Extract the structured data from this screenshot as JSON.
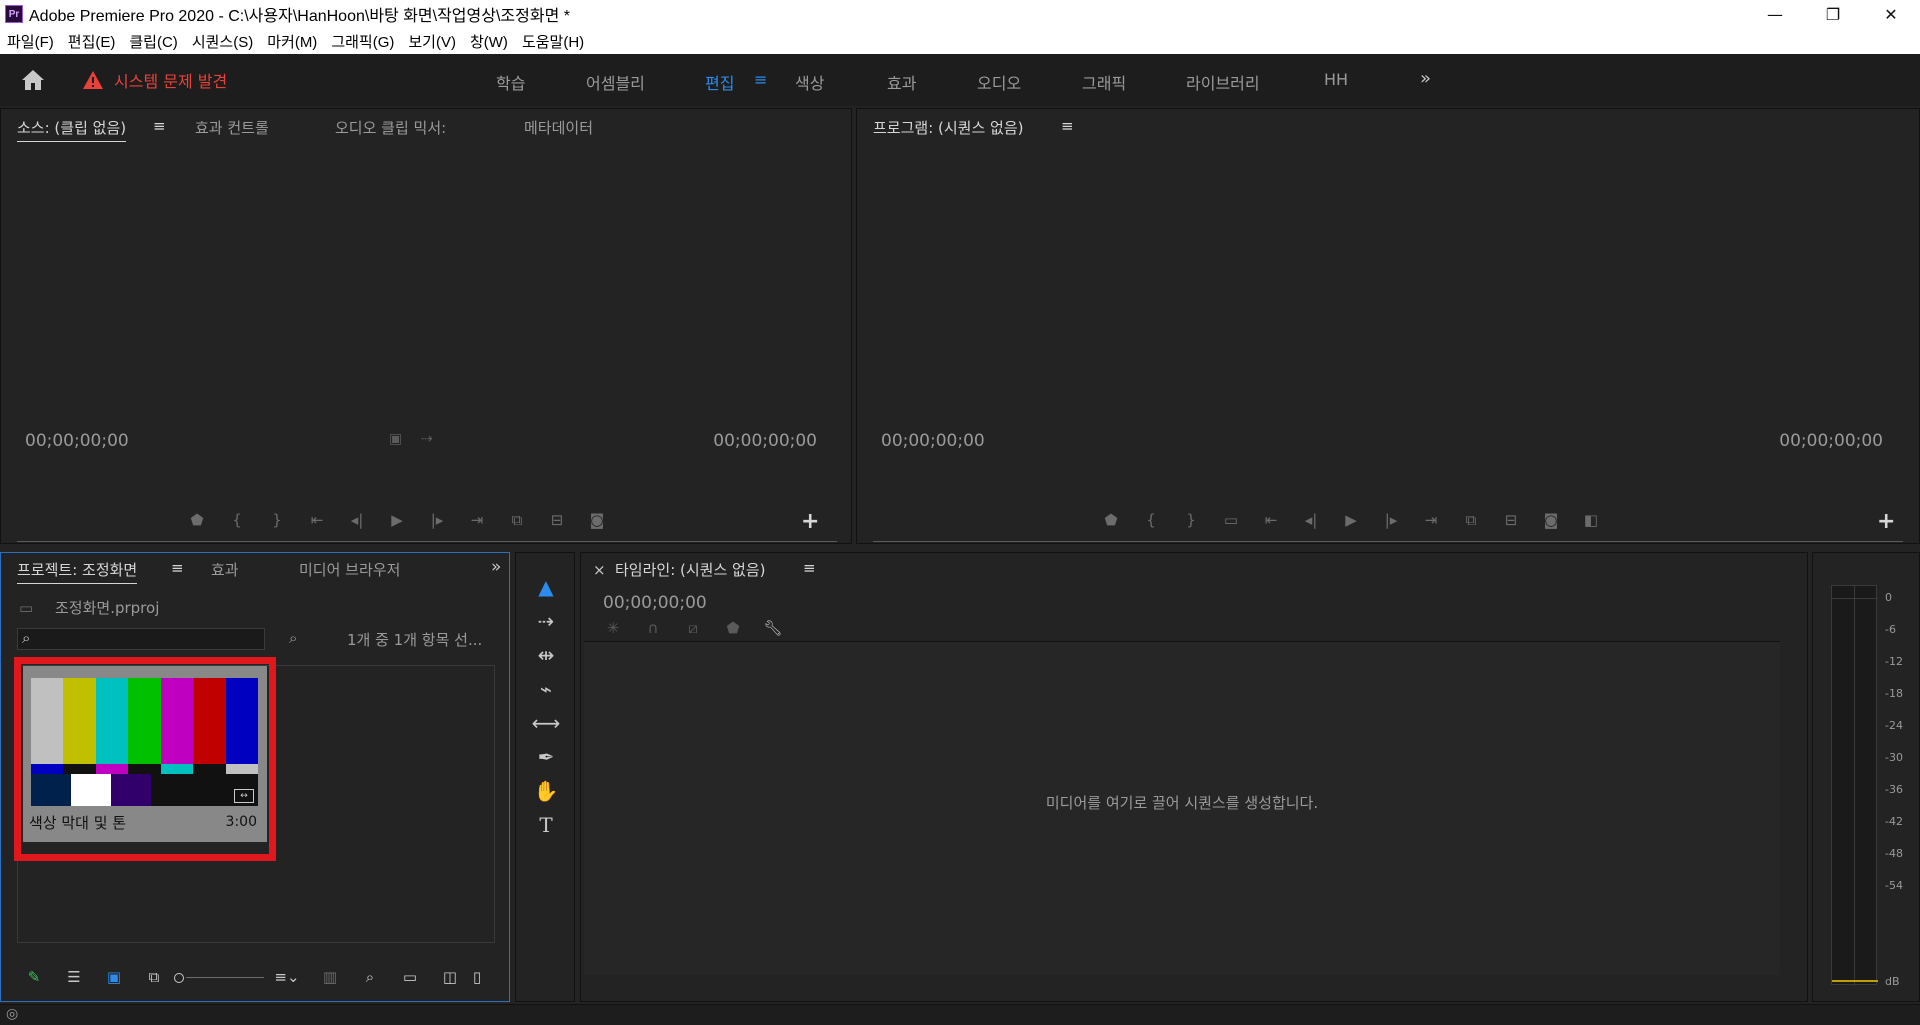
{
  "window": {
    "title": "Adobe Premiere Pro 2020 - C:\\사용자\\HanHoon\\바탕 화면\\작업영상\\조정화면 *",
    "logo": "Pr",
    "minimize": "—",
    "restore": "❐",
    "close": "✕"
  },
  "menu": [
    "파일(F)",
    "편집(E)",
    "클립(C)",
    "시퀀스(S)",
    "마커(M)",
    "그래픽(G)",
    "보기(V)",
    "창(W)",
    "도움말(H)"
  ],
  "workspace": {
    "warning": "시스템 문제 발견",
    "tabs": [
      "학습",
      "어셈블리",
      "편집",
      "색상",
      "효과",
      "오디오",
      "그래픽",
      "라이브러리",
      "HH"
    ],
    "active_tab": "편집",
    "menu_glyph": "≡",
    "more_glyph": "»"
  },
  "source": {
    "tabs": [
      "소스: (클립 없음)",
      "효과 컨트롤",
      "오디오 클립 믹서:",
      "메타데이터"
    ],
    "menu_glyph": "≡",
    "tc_left": "00;00;00;00",
    "tc_right": "00;00;00;00"
  },
  "program": {
    "tab": "프로그램: (시퀀스 없음)",
    "menu_glyph": "≡",
    "tc_left": "00;00;00;00",
    "tc_right": "00;00;00;00"
  },
  "project": {
    "tabs": [
      "프로젝트: 조정화면",
      "효과",
      "미디어 브라우저"
    ],
    "menu_glyph": "≡",
    "file": "조정화면.prproj",
    "count": "1개 중 1개 항목 선...",
    "item": {
      "label": "색상 막대 및 톤",
      "duration": "3:00"
    }
  },
  "timeline": {
    "close": "×",
    "tab": "타임라인: (시퀀스 없음)",
    "menu_glyph": "≡",
    "tc": "00;00;00;00",
    "hint": "미디어를 여기로 끌어 시퀀스를 생성합니다."
  },
  "meter": {
    "labels": [
      "0",
      "-6",
      "-12",
      "-18",
      "-24",
      "-30",
      "-36",
      "-42",
      "-48",
      "-54",
      "dB"
    ]
  },
  "colors": {
    "accent": "#2d8ceb",
    "warning": "#e8403a",
    "selection": "#e0181e"
  }
}
